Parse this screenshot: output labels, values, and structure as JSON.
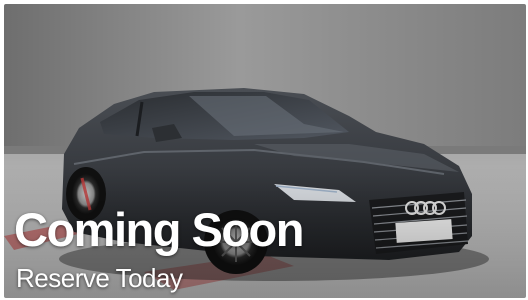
{
  "banner": {
    "headline": "Coming Soon",
    "subline": "Reserve Today"
  },
  "photo": {
    "subject": "car-photo",
    "car_color": "#3a3d42",
    "wall_color": "#8a8a8a",
    "floor_color": "#c9c9c9",
    "floor_marking_color": "#c23a3a"
  }
}
